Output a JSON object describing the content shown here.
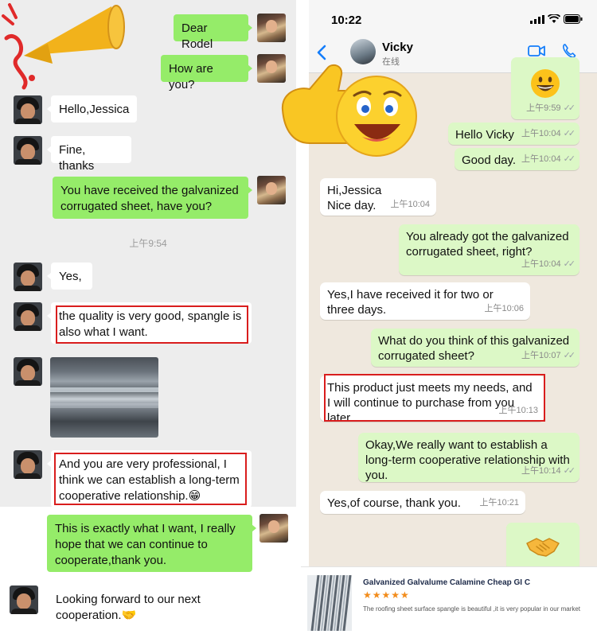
{
  "left_chat": {
    "messages": {
      "dear_rodel": "Dear Rodel",
      "how_are_you": "How are you?",
      "hello_jessica": "Hello,Jessica",
      "fine_thanks": "Fine, thanks",
      "received_question": "You have received the galvanized corrugated sheet, have you?",
      "yes": "Yes,",
      "quality_good": "the quality is very good, spangle is also what I want.",
      "professional": "And you are very professional, I think we can establish a long-term cooperative relationship.😁",
      "exactly_want": "This is exactly what I want, I really hope that we can continue to cooperate,thank you.",
      "looking_forward": "Looking forward to our next cooperation.🤝"
    },
    "timestamp": "上午9:54"
  },
  "right_chat": {
    "status_time": "10:22",
    "contact_name": "Vicky",
    "contact_status": "在线",
    "messages": {
      "smile_time": "上午9:59",
      "hello_vicky": "Hello Vicky",
      "hello_vicky_time": "上午10:04",
      "good_day": "Good day.",
      "good_day_time": "上午10:04",
      "hi_jessica_1": "Hi,Jessica",
      "hi_jessica_2": "Nice day.",
      "hi_jessica_time": "上午10:04",
      "already_got": "You already got the galvanized corrugated sheet, right?",
      "already_got_time": "上午10:04",
      "received_two_three": "Yes,I have received it for two or three days.",
      "received_two_three_time": "上午10:06",
      "what_think": "What do you think of this galvanized corrugated sheet?",
      "what_think_time": "上午10:07",
      "meets_needs": "This product just meets my needs, and I will continue to purchase from you later.",
      "meets_needs_time": "上午10:13",
      "establish": "Okay,We really want to establish a long-term cooperative relationship with you.",
      "establish_time": "上午10:14",
      "of_course": "Yes,of course, thank you.",
      "of_course_time": "上午10:21"
    }
  },
  "product_card": {
    "title": "Galvanized Galvalume Calamine Cheap GI Corr...",
    "stars": "★★★★★",
    "description": "The roofing sheet surface spangle is beautiful ,it is very popular in our market"
  },
  "colors": {
    "wechat_green": "#95ec69",
    "whatsapp_green": "#dcf8c6",
    "highlight_red": "#d91d1d",
    "ios_blue": "#147efb"
  }
}
